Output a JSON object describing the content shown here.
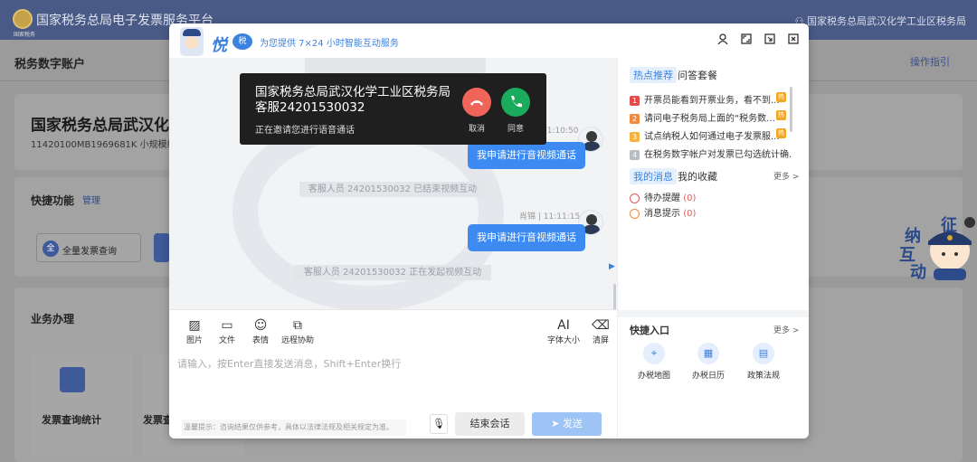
{
  "page": {
    "emblem_caption": "国家税务",
    "platform_title": "国家税务总局电子发票服务平台",
    "department": "国家税务总局武汉化学工业区税务局",
    "subheader_title": "税务数字账户",
    "operation_guide": "操作指引",
    "company_name": "国家税务总局武汉化",
    "tax_id": "11420100MB1969681K 小规模纳",
    "quick_title": "快捷功能",
    "quick_manage": "管理",
    "quick_btn": "全量发票查询",
    "business_title": "业务办理",
    "tile1": "发票查询统计",
    "tile2": "发票查",
    "mascot_words": [
      "征",
      "纳",
      "互",
      "动"
    ]
  },
  "modal": {
    "logo_text": "悦",
    "logo_badge": "税",
    "slogan": "为您提供 7×24 小时智能互动服务",
    "controls": [
      "user-icon",
      "expand-icon",
      "minimize-icon",
      "close-icon"
    ],
    "chat": {
      "top_sysmsg": "",
      "msg1_meta": "11:10:50",
      "msg1_text": "我申请进行音视频通话",
      "sys1": "客服人员 24201530032 已结束视频互动",
      "msg2_meta": "肖锦 | 11:11:15",
      "msg2_text": "我申请进行音视频通话",
      "sys2": "客服人员 24201530032 正在发起视频互动"
    },
    "call": {
      "name": "国家税务总局武汉化学工业区税务局客服24201530032",
      "status": "正在邀请您进行语音通话",
      "decline_label": "取消",
      "accept_label": "同意"
    },
    "toolbar": {
      "image": "图片",
      "file": "文件",
      "emoji": "表情",
      "remote": "远程协助",
      "font_icon": "AI",
      "font": "字体大小",
      "clear": "清屏"
    },
    "input_placeholder": "请输入，按Enter直接发送消息，Shift+Enter换行",
    "tip": "温馨提示：咨询结果仅供参考，具体以法律法规及相关规定为准。",
    "end_btn": "结束会话",
    "send_btn": "发送",
    "right": {
      "tab_hot": "热点推荐",
      "tab_qa": "问答套餐",
      "hot_items": [
        {
          "num": "1",
          "text": "开票员能看到开票业务，看不到..."
        },
        {
          "num": "2",
          "text": "请问电子税务局上面的“税务数..."
        },
        {
          "num": "3",
          "text": "试点纳税人如何通过电子发票服..."
        },
        {
          "num": "4",
          "text": "在税务数字帐户对发票已勾选统计确..."
        }
      ],
      "hot_tag": "热",
      "tab_mymsg": "我的消息",
      "tab_fav": "我的收藏",
      "more": "更多 >",
      "todo": "待办提醒",
      "todo_count": "(0)",
      "notice": "消息提示",
      "notice_count": "(0)",
      "quick_entry": "快捷入口",
      "entries": [
        "办税地图",
        "办税日历",
        "政策法规"
      ]
    }
  }
}
